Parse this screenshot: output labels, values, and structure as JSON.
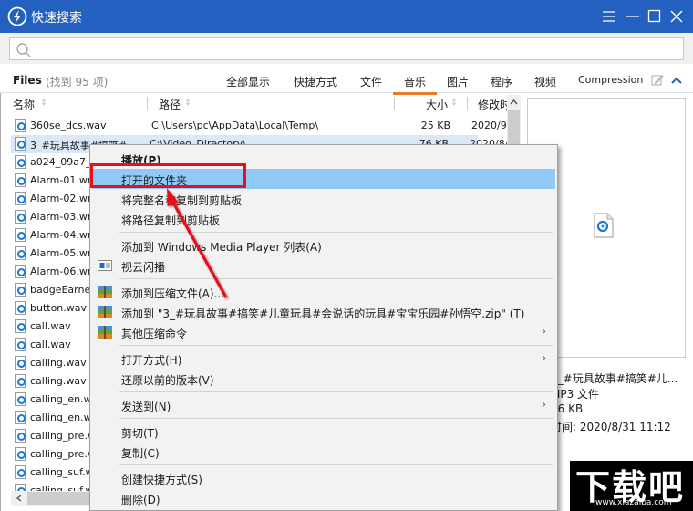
{
  "window": {
    "title": "快速搜索",
    "controls": [
      "menu",
      "minimize",
      "maximize",
      "close"
    ]
  },
  "search": {
    "value": "",
    "placeholder": ""
  },
  "filesbar": {
    "label": "Files",
    "count": "(找到 95 项)",
    "tabs": [
      {
        "label": "全部显示",
        "active": false
      },
      {
        "label": "快捷方式",
        "active": false
      },
      {
        "label": "文件",
        "active": false
      },
      {
        "label": "音乐",
        "active": true
      },
      {
        "label": "图片",
        "active": false
      },
      {
        "label": "程序",
        "active": false
      },
      {
        "label": "视频",
        "active": false
      },
      {
        "label": "Compression",
        "active": false
      }
    ],
    "accent": "#e87a2a"
  },
  "table": {
    "columns": [
      "名称",
      "路径",
      "大小",
      "修改时"
    ],
    "rows": [
      {
        "name": "360se_dcs.wav",
        "path": "C:\\Users\\pc\\AppData\\Local\\Temp\\",
        "size": "25 KB",
        "date": "2020/9/"
      },
      {
        "name": "3_#玩具故事#搞笑#...",
        "path": "C:\\Video_Directory\\",
        "size": "76 KB",
        "date": "2020/8/",
        "selected": true
      },
      {
        "name": "a024_09a7_c",
        "path": "",
        "size": "",
        "date": ""
      },
      {
        "name": "Alarm-01.wm",
        "path": "",
        "size": "",
        "date": ""
      },
      {
        "name": "Alarm-02.wm",
        "path": "",
        "size": "",
        "date": ""
      },
      {
        "name": "Alarm-03.wm",
        "path": "",
        "size": "",
        "date": ""
      },
      {
        "name": "Alarm-04.wm",
        "path": "",
        "size": "",
        "date": ""
      },
      {
        "name": "Alarm-05.wm",
        "path": "",
        "size": "",
        "date": ""
      },
      {
        "name": "Alarm-06.wm",
        "path": "",
        "size": "",
        "date": ""
      },
      {
        "name": "badgeEarned",
        "path": "",
        "size": "",
        "date": ""
      },
      {
        "name": "button.wav",
        "path": "",
        "size": "",
        "date": ""
      },
      {
        "name": "call.wav",
        "path": "",
        "size": "",
        "date": ""
      },
      {
        "name": "call.wav",
        "path": "",
        "size": "",
        "date": ""
      },
      {
        "name": "calling.wav",
        "path": "",
        "size": "",
        "date": ""
      },
      {
        "name": "calling.wav",
        "path": "",
        "size": "",
        "date": ""
      },
      {
        "name": "calling_en.wa",
        "path": "",
        "size": "",
        "date": ""
      },
      {
        "name": "calling_en.wa",
        "path": "",
        "size": "",
        "date": ""
      },
      {
        "name": "calling_pre.w",
        "path": "",
        "size": "",
        "date": ""
      },
      {
        "name": "calling_pre.w",
        "path": "",
        "size": "",
        "date": ""
      },
      {
        "name": "calling_suf.wa",
        "path": "",
        "size": "",
        "date": ""
      },
      {
        "name": "calling_suf.wa",
        "path": "",
        "size": "",
        "date": ""
      }
    ]
  },
  "preview": {
    "name": "3_#玩具故事#搞笑#儿...",
    "type": "MP3 文件",
    "size": "76 KB",
    "modified": "时间: 2020/8/31 11:12"
  },
  "context_menu": {
    "items": [
      {
        "label": "播放(P)",
        "bold": true
      },
      {
        "label": "打开的文件夹",
        "highlighted": true
      },
      {
        "label": "将完整名称复制到剪贴板"
      },
      {
        "label": "将路径复制到剪贴板"
      },
      {
        "separator": true
      },
      {
        "label": "添加到 Windows Media Player 列表(A)"
      },
      {
        "label": "视云闪播",
        "icon": "window-icon"
      },
      {
        "separator": true
      },
      {
        "label": "添加到压缩文件(A)...",
        "icon": "archive-icon"
      },
      {
        "label": "添加到 \"3_#玩具故事#搞笑#儿童玩具#会说话的玩具#宝宝乐园#孙悟空.zip\" (T)",
        "icon": "archive-icon"
      },
      {
        "label": "其他压缩命令",
        "icon": "archive-icon",
        "submenu": true
      },
      {
        "separator": true
      },
      {
        "label": "打开方式(H)",
        "submenu": true
      },
      {
        "label": "还原以前的版本(V)"
      },
      {
        "separator": true
      },
      {
        "label": "发送到(N)",
        "submenu": true
      },
      {
        "separator": true
      },
      {
        "label": "剪切(T)"
      },
      {
        "label": "复制(C)"
      },
      {
        "separator": true
      },
      {
        "label": "创建快捷方式(S)"
      },
      {
        "label": "删除(D)"
      }
    ],
    "highlight_color": "#91c9f7",
    "annotation_color": "#e8101c"
  },
  "watermark": {
    "text": "下载吧",
    "url": "www.xiazaiba.com"
  }
}
